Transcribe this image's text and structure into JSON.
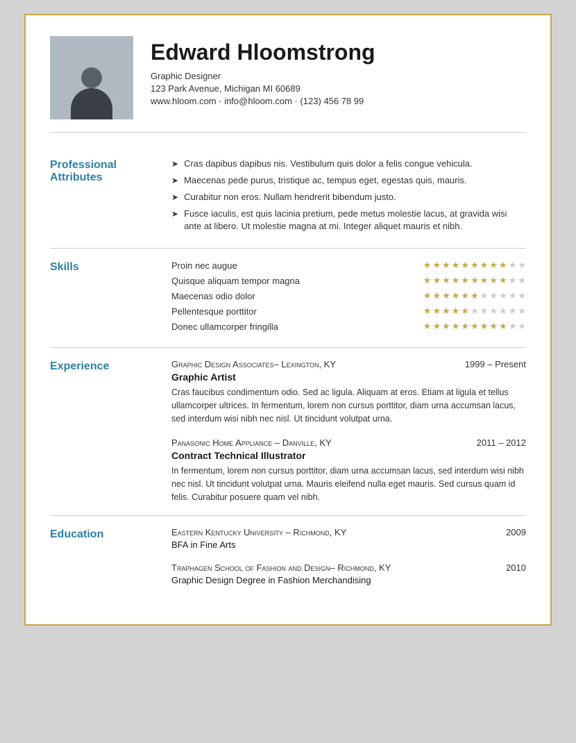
{
  "header": {
    "name": "Edward Hloomstrong",
    "title": "Graphic Designer",
    "address": "123 Park Avenue, Michigan MI 60689",
    "contact": "www.hloom.com · info@hloom.com · (123) 456 78 99"
  },
  "professional_attributes": {
    "label": "Professional Attributes",
    "items": [
      "Cras dapibus dapibus nis. Vestibulum quis dolor a felis congue vehicula.",
      "Maecenas pede purus, tristique ac, tempus eget, egestas quis, mauris.",
      "Curabitur non eros. Nullam hendrerit bibendum justo.",
      "Fusce iaculis, est quis lacinia pretium, pede metus molestie lacus, at gravida wisi ante at libero. Ut molestie magna at mi. Integer aliquet mauris et nibh."
    ]
  },
  "skills": {
    "label": "Skills",
    "items": [
      {
        "name": "Proin nec augue",
        "filled": 9,
        "total": 11
      },
      {
        "name": "Quisque aliquam tempor magna",
        "filled": 9,
        "total": 11
      },
      {
        "name": "Maecenas odio dolor",
        "filled": 6,
        "total": 11
      },
      {
        "name": "Pellentesque porttitor",
        "filled": 5,
        "total": 11
      },
      {
        "name": "Donec ullamcorper fringilla",
        "filled": 9,
        "total": 11
      }
    ]
  },
  "experience": {
    "label": "Experience",
    "items": [
      {
        "company": "Graphic Design Associates– Lexington, KY",
        "dates": "1999 – Present",
        "role": "Graphic Artist",
        "description": "Cras faucibus condimentum odio. Sed ac ligula. Aliquam at eros. Etiam at ligula et tellus ullamcorper ultrices. In fermentum, lorem non cursus porttitor, diam urna accumsan lacus, sed interdum wisi nibh nec nisl. Ut tincidunt volutpat urna."
      },
      {
        "company": "Panasonic Home Appliance – Danville, KY",
        "dates": "2011 – 2012",
        "role": "Contract Technical Illustrator",
        "description": "In fermentum, lorem non cursus porttitor, diam urna accumsan lacus, sed interdum wisi nibh nec nisl. Ut tincidunt volutpat urna. Mauris eleifend nulla eget mauris. Sed cursus quam id felis. Curabitur posuere quam vel nibh."
      }
    ]
  },
  "education": {
    "label": "Education",
    "items": [
      {
        "school": "Eastern Kentucky University – Richmond, KY",
        "year": "2009",
        "degree": "BFA in Fine Arts"
      },
      {
        "school": "Traphagen School of Fashion and Design– Richmond, KY",
        "year": "2010",
        "degree": "Graphic Design Degree in Fashion Merchandising"
      }
    ]
  }
}
